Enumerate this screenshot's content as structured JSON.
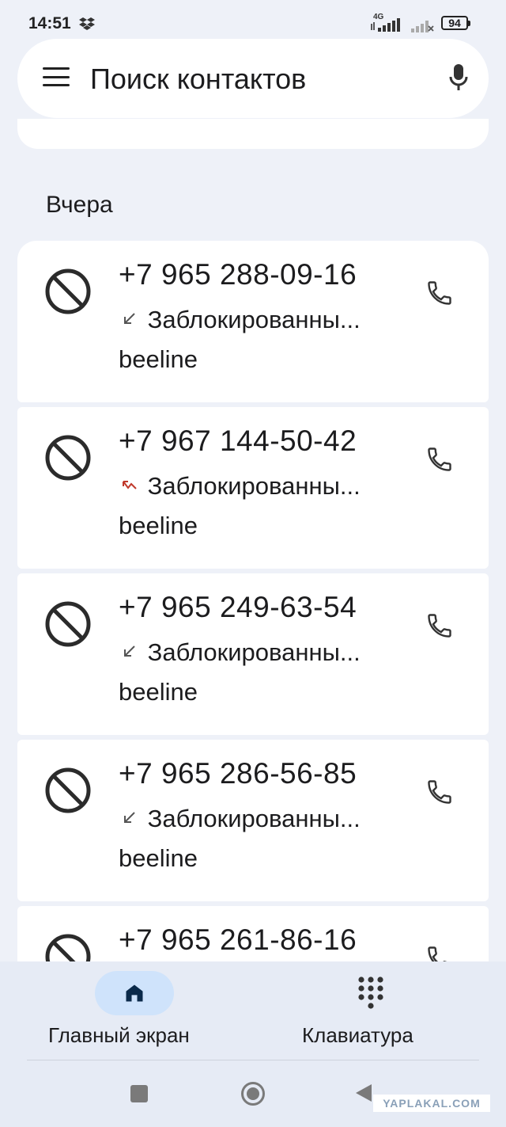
{
  "status": {
    "time": "14:51",
    "network": "4G",
    "battery": "94"
  },
  "search": {
    "placeholder": "Поиск контактов"
  },
  "section": {
    "title": "Вчера"
  },
  "calls": [
    {
      "number": "+7 965 288-09-16",
      "status": "Заблокированны...",
      "carrier": "beeline",
      "missed": false
    },
    {
      "number": "+7 967 144-50-42",
      "status": "Заблокированны...",
      "carrier": "beeline",
      "missed": true
    },
    {
      "number": "+7 965 249-63-54",
      "status": "Заблокированны...",
      "carrier": "beeline",
      "missed": false
    },
    {
      "number": "+7 965 286-56-85",
      "status": "Заблокированны...",
      "carrier": "beeline",
      "missed": false
    },
    {
      "number": "+7 965 261-86-16"
    }
  ],
  "nav": {
    "home": "Главный экран",
    "keypad": "Клавиатура"
  },
  "watermark": "YAPLAKAL.COM",
  "colors": {
    "missed_arrow": "#c0392b",
    "incoming_arrow": "#555555",
    "active_pill": "#cfe3fb"
  }
}
